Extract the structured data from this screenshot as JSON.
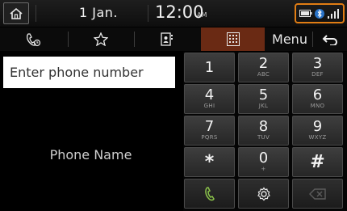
{
  "status_bar": {
    "date": "1 Jan.",
    "time": "12:00",
    "ampm": "AM",
    "icons": [
      "battery-icon",
      "bluetooth-icon",
      "signal-icon"
    ],
    "accent_color": "#e07d14"
  },
  "toolbar": {
    "tabs": [
      "recent-calls-icon",
      "favorites-icon",
      "contacts-icon",
      "keypad-icon"
    ],
    "active_tab": "keypad",
    "menu_label": "Menu",
    "back_icon": "back-arrow-icon"
  },
  "dial_panel": {
    "input_placeholder": "Enter phone number",
    "phone_name": "Phone Name"
  },
  "keypad": {
    "keys": [
      {
        "num": "1",
        "sub": ""
      },
      {
        "num": "2",
        "sub": "ABC"
      },
      {
        "num": "3",
        "sub": "DEF"
      },
      {
        "num": "4",
        "sub": "GHI"
      },
      {
        "num": "5",
        "sub": "JKL"
      },
      {
        "num": "6",
        "sub": "MNO"
      },
      {
        "num": "7",
        "sub": "PQRS"
      },
      {
        "num": "8",
        "sub": "TUV"
      },
      {
        "num": "9",
        "sub": "WXYZ"
      },
      {
        "num": "*",
        "sub": ""
      },
      {
        "num": "0",
        "sub": "+"
      },
      {
        "num": "#",
        "sub": ""
      }
    ],
    "actions": [
      "call-icon",
      "settings-icon",
      "delete-icon"
    ],
    "call_color": "#8bc34a"
  }
}
